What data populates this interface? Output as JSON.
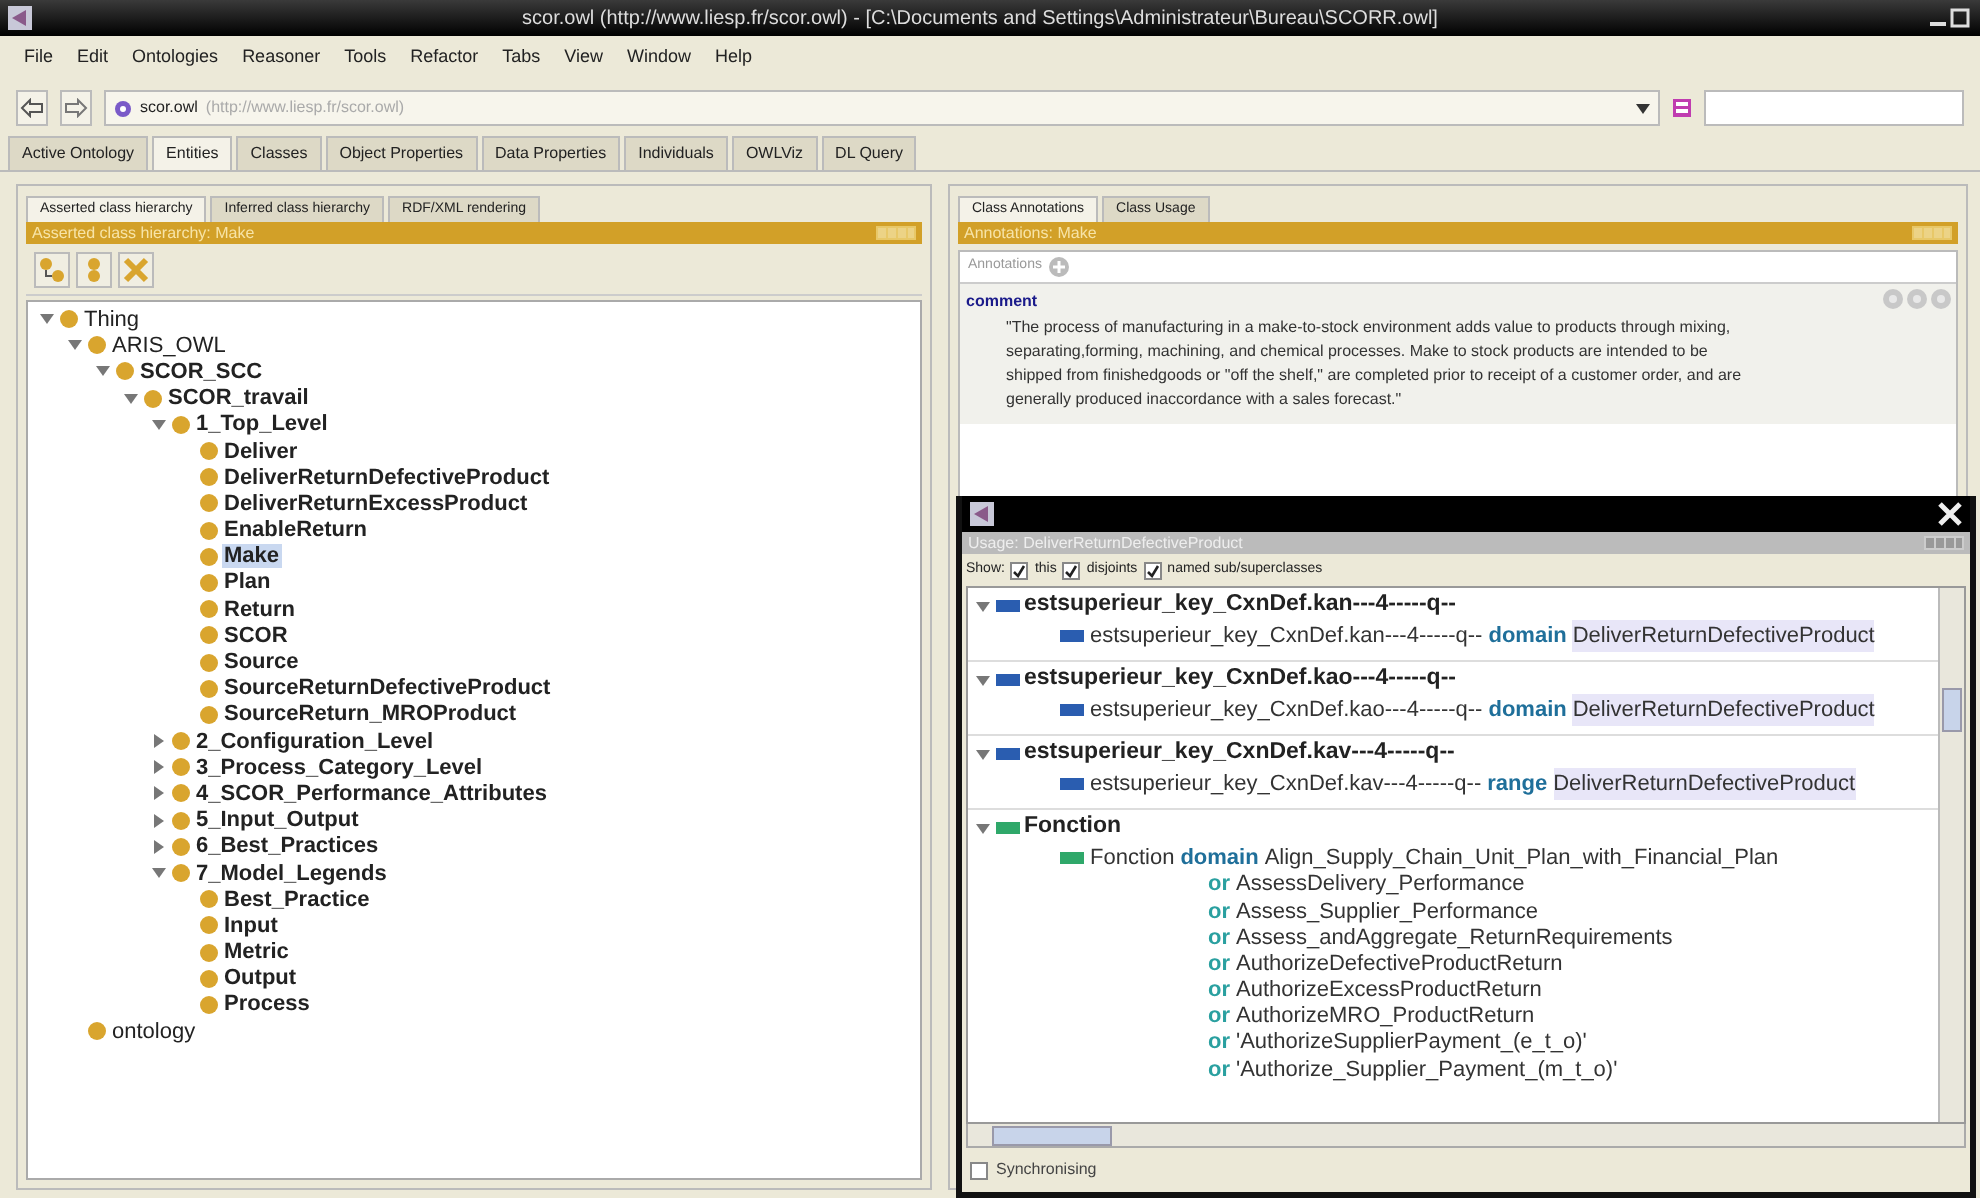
{
  "window": {
    "title": "scor.owl (http://www.liesp.fr/scor.owl) - [C:\\Documents and Settings\\Administrateur\\Bureau\\SCORR.owl]"
  },
  "menu": [
    "File",
    "Edit",
    "Ontologies",
    "Reasoner",
    "Tools",
    "Refactor",
    "Tabs",
    "View",
    "Window",
    "Help"
  ],
  "address": {
    "name": "scor.owl",
    "uri": "(http://www.liesp.fr/scor.owl)"
  },
  "tabs": [
    {
      "label": "Active Ontology",
      "selected": false
    },
    {
      "label": "Entities",
      "selected": true
    },
    {
      "label": "Classes",
      "selected": false
    },
    {
      "label": "Object Properties",
      "selected": false
    },
    {
      "label": "Data Properties",
      "selected": false
    },
    {
      "label": "Individuals",
      "selected": false
    },
    {
      "label": "OWLViz",
      "selected": false
    },
    {
      "label": "DL Query",
      "selected": false
    }
  ],
  "left_panel": {
    "tabs": [
      {
        "label": "Asserted class hierarchy",
        "selected": true
      },
      {
        "label": "Inferred class hierarchy",
        "selected": false
      },
      {
        "label": "RDF/XML rendering",
        "selected": false
      }
    ],
    "header": "Asserted class hierarchy: Make",
    "tree": [
      {
        "label": "Thing",
        "bold": false,
        "selected": false,
        "expanded": true,
        "children": [
          {
            "label": "ARIS_OWL",
            "bold": false,
            "selected": false,
            "expanded": true,
            "children": [
              {
                "label": "SCOR_SCC",
                "bold": true,
                "selected": false,
                "expanded": true,
                "children": [
                  {
                    "label": "SCOR_travail",
                    "bold": true,
                    "selected": false,
                    "expanded": true,
                    "children": [
                      {
                        "label": "1_Top_Level",
                        "bold": true,
                        "selected": false,
                        "expanded": true,
                        "children": [
                          {
                            "label": "Deliver",
                            "bold": true,
                            "selected": false
                          },
                          {
                            "label": "DeliverReturnDefectiveProduct",
                            "bold": true,
                            "selected": false
                          },
                          {
                            "label": "DeliverReturnExcessProduct",
                            "bold": true,
                            "selected": false
                          },
                          {
                            "label": "EnableReturn",
                            "bold": true,
                            "selected": false
                          },
                          {
                            "label": "Make",
                            "bold": true,
                            "selected": true
                          },
                          {
                            "label": "Plan",
                            "bold": true,
                            "selected": false
                          },
                          {
                            "label": "Return",
                            "bold": true,
                            "selected": false
                          },
                          {
                            "label": "SCOR",
                            "bold": true,
                            "selected": false
                          },
                          {
                            "label": "Source",
                            "bold": true,
                            "selected": false
                          },
                          {
                            "label": "SourceReturnDefectiveProduct",
                            "bold": true,
                            "selected": false
                          },
                          {
                            "label": "SourceReturn_MROProduct",
                            "bold": true,
                            "selected": false
                          }
                        ]
                      },
                      {
                        "label": "2_Configuration_Level",
                        "bold": true,
                        "selected": false,
                        "expanded": false
                      },
                      {
                        "label": "3_Process_Category_Level",
                        "bold": true,
                        "selected": false,
                        "expanded": false
                      },
                      {
                        "label": "4_SCOR_Performance_Attributes",
                        "bold": true,
                        "selected": false,
                        "expanded": false
                      },
                      {
                        "label": "5_Input_Output",
                        "bold": true,
                        "selected": false,
                        "expanded": false
                      },
                      {
                        "label": "6_Best_Practices",
                        "bold": true,
                        "selected": false,
                        "expanded": false
                      },
                      {
                        "label": "7_Model_Legends",
                        "bold": true,
                        "selected": false,
                        "expanded": true,
                        "children": [
                          {
                            "label": "Best_Practice",
                            "bold": true,
                            "selected": false
                          },
                          {
                            "label": "Input",
                            "bold": true,
                            "selected": false
                          },
                          {
                            "label": "Metric",
                            "bold": true,
                            "selected": false
                          },
                          {
                            "label": "Output",
                            "bold": true,
                            "selected": false
                          },
                          {
                            "label": "Process",
                            "bold": true,
                            "selected": false
                          }
                        ]
                      }
                    ]
                  }
                ]
              }
            ]
          },
          {
            "label": "ontology",
            "bold": false,
            "selected": false
          }
        ]
      }
    ]
  },
  "right_panel": {
    "tabs": [
      {
        "label": "Class Annotations",
        "selected": true
      },
      {
        "label": "Class Usage",
        "selected": false
      }
    ],
    "header": "Annotations: Make",
    "annotations_label": "Annotations",
    "annotation": {
      "property": "comment",
      "value": "\"The process of manufacturing in a make-to-stock environment adds value to products through mixing, separating,forming, machining, and chemical processes. Make to stock products are intended to be shipped from finishedgoods or \"off the shelf,\" are completed prior to receipt of a customer order, and are generally produced inaccordance with a sales forecast.\""
    }
  },
  "usage_window": {
    "header": "Usage: DeliverReturnDefectiveProduct",
    "show_label": "Show:",
    "filters": [
      {
        "label": "this",
        "checked": true
      },
      {
        "label": "disjoints",
        "checked": true
      },
      {
        "label": "named sub/superclasses",
        "checked": true
      }
    ],
    "groups": [
      {
        "title": "estsuperieur_key_CxnDef.kan---4-----q--",
        "color": "#2a5db0",
        "subject": "estsuperieur_key_CxnDef.kan---4-----q--",
        "keyword": "domain",
        "target": "DeliverReturnDefectiveProduct",
        "target_highlighted": true
      },
      {
        "title": "estsuperieur_key_CxnDef.kao---4-----q--",
        "color": "#2a5db0",
        "subject": "estsuperieur_key_CxnDef.kao---4-----q--",
        "keyword": "domain",
        "target": "DeliverReturnDefectiveProduct",
        "target_highlighted": true
      },
      {
        "title": "estsuperieur_key_CxnDef.kav---4-----q--",
        "color": "#2a5db0",
        "subject": "estsuperieur_key_CxnDef.kav---4-----q--",
        "keyword": "range",
        "target": "DeliverReturnDefectiveProduct",
        "target_highlighted": true
      },
      {
        "title": "Fonction",
        "color": "#2fa86a",
        "subject": "Fonction",
        "keyword": "domain",
        "target": "Align_Supply_Chain_Unit_Plan_with_Financial_Plan",
        "target_highlighted": false,
        "alternatives": [
          {
            "keyword": "or",
            "target": "AssessDelivery_Performance"
          },
          {
            "keyword": "or",
            "target": "Assess_Supplier_Performance"
          },
          {
            "keyword": "or",
            "target": "Assess_andAggregate_ReturnRequirements"
          },
          {
            "keyword": "or",
            "target": "AuthorizeDefectiveProductReturn"
          },
          {
            "keyword": "or",
            "target": "AuthorizeExcessProductReturn"
          },
          {
            "keyword": "or",
            "target": "AuthorizeMRO_ProductReturn"
          },
          {
            "keyword": "or",
            "target": "'AuthorizeSupplierPayment_(e_t_o)'"
          },
          {
            "keyword": "or",
            "target": "'Authorize_Supplier_Payment_(m_t_o)'"
          }
        ]
      }
    ],
    "synchronising": {
      "label": "Synchronising",
      "checked": false
    }
  }
}
